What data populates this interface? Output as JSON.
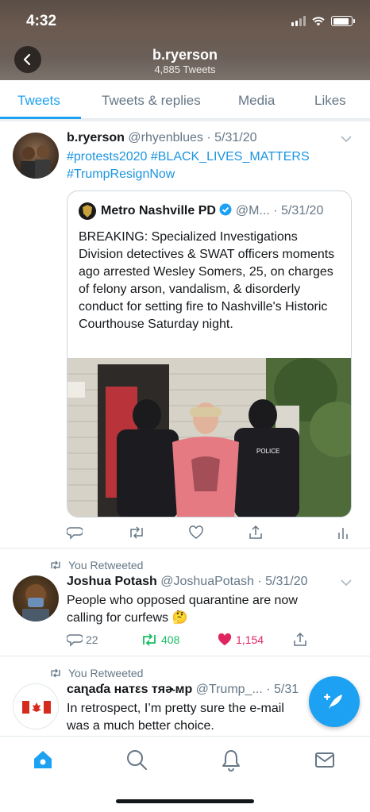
{
  "status_bar": {
    "time": "4:32"
  },
  "header": {
    "title": "b.ryerson",
    "subtitle": "4,885 Tweets"
  },
  "tabs": [
    {
      "label": "Tweets",
      "active": true
    },
    {
      "label": "Tweets & replies",
      "active": false
    },
    {
      "label": "Media",
      "active": false
    },
    {
      "label": "Likes",
      "active": false
    }
  ],
  "tweets": [
    {
      "name": "b.ryerson",
      "meta": "@rhyenblues · 5/31/20",
      "line1": "#protests2020 #BLACK_LIVES_MATTERS",
      "line2": "#TrumpResignNow",
      "quote": {
        "name": "Metro Nashville PD",
        "meta": "@M... · 5/31/20",
        "text": "BREAKING: Specialized Investigations Division detectives & SWAT officers moments ago arrested Wesley Somers, 25, on charges of felony arson, vandalism, & disorderly conduct for setting fire to Nashville's Historic Courthouse Saturday night.",
        "image_shirt_text": "POLICE"
      }
    },
    {
      "retweet_label": "You Retweeted",
      "name": "Joshua Potash",
      "meta": "@JoshuaPotash · 5/31/20",
      "text": "People who opposed quarantine are now calling for curfews 🤔",
      "replies": "22",
      "retweets": "408",
      "likes": "1,154"
    },
    {
      "retweet_label": "You Retweeted",
      "name": "caɳaɗa нaтεs тяɚмp",
      "meta": "@Trump_... · 5/31",
      "text_line1": "In retrospect, I’m pretty sure the e-mail",
      "text_line2": "was a much better choice."
    }
  ],
  "colors": {
    "accent": "#1da1f2",
    "like": "#e0245e",
    "retweet": "#17bf63",
    "secondary": "#657786"
  },
  "icons": [
    "back-arrow-icon",
    "reply-icon",
    "retweet-icon",
    "like-icon",
    "share-icon",
    "analytics-icon",
    "home-icon",
    "search-icon",
    "notifications-icon",
    "messages-icon",
    "compose-tweet-icon"
  ]
}
